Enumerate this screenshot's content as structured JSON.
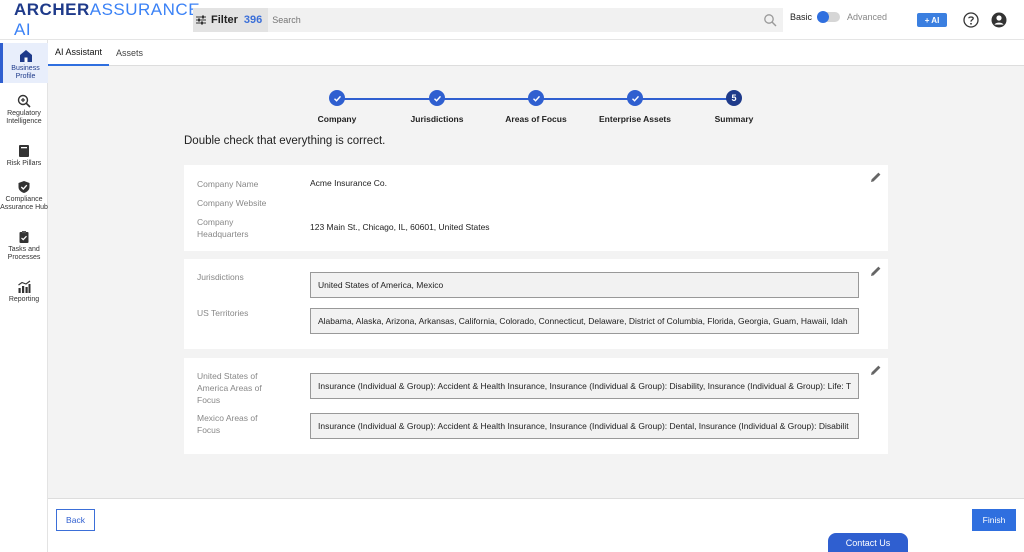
{
  "app": {
    "brand_bold": "ARCHER",
    "brand_light": "ASSURANCE AI"
  },
  "header": {
    "filter_label": "Filter",
    "filter_count": "396",
    "search_placeholder": "Search",
    "mode_basic": "Basic",
    "mode_advanced": "Advanced",
    "ai_button": "+ AI"
  },
  "sidebar": {
    "items": [
      {
        "label": "Business Profile",
        "icon": "home-icon"
      },
      {
        "label": "Regulatory Intelligence",
        "icon": "magnify-plus-icon"
      },
      {
        "label": "Risk Pillars",
        "icon": "book-icon"
      },
      {
        "label": "Compliance Assurance Hub",
        "icon": "shield-check-icon"
      },
      {
        "label": "Tasks and Processes",
        "icon": "clipboard-icon"
      },
      {
        "label": "Reporting",
        "icon": "chart-icon"
      }
    ]
  },
  "tabs": [
    {
      "label": "AI Assistant"
    },
    {
      "label": "Assets"
    }
  ],
  "stepper": {
    "steps": [
      {
        "label": "Company",
        "state": "done"
      },
      {
        "label": "Jurisdictions",
        "state": "done"
      },
      {
        "label": "Areas of Focus",
        "state": "done"
      },
      {
        "label": "Enterprise Assets",
        "state": "done"
      },
      {
        "label": "Summary",
        "state": "current",
        "number": "5"
      }
    ]
  },
  "heading": "Double check that everything is correct.",
  "company_card": {
    "name_label": "Company Name",
    "name_value": "Acme Insurance Co.",
    "website_label": "Company Website",
    "hq_label": "Company Headquarters",
    "hq_value": "123 Main St., Chicago, IL, 60601, United States"
  },
  "jurisdictions_card": {
    "jurisdictions_label": "Jurisdictions",
    "jurisdictions_value": "United States of America, Mexico",
    "territories_label": "US Territories",
    "territories_value": "Alabama, Alaska, Arizona, Arkansas, California, Colorado, Connecticut, Delaware, District of Columbia, Florida, Georgia, Guam, Hawaii, Idah"
  },
  "focus_card": {
    "us_label": "United States of America Areas of Focus",
    "us_value": "Insurance (Individual & Group): Accident & Health Insurance, Insurance (Individual & Group): Disability, Insurance (Individual & Group): Life: T",
    "mx_label": "Mexico Areas of Focus",
    "mx_value": "Insurance (Individual & Group): Accident & Health Insurance, Insurance (Individual & Group): Dental, Insurance (Individual & Group): Disabilit"
  },
  "footer": {
    "back_label": "Back",
    "finish_label": "Finish",
    "contact_label": "Contact Us"
  }
}
